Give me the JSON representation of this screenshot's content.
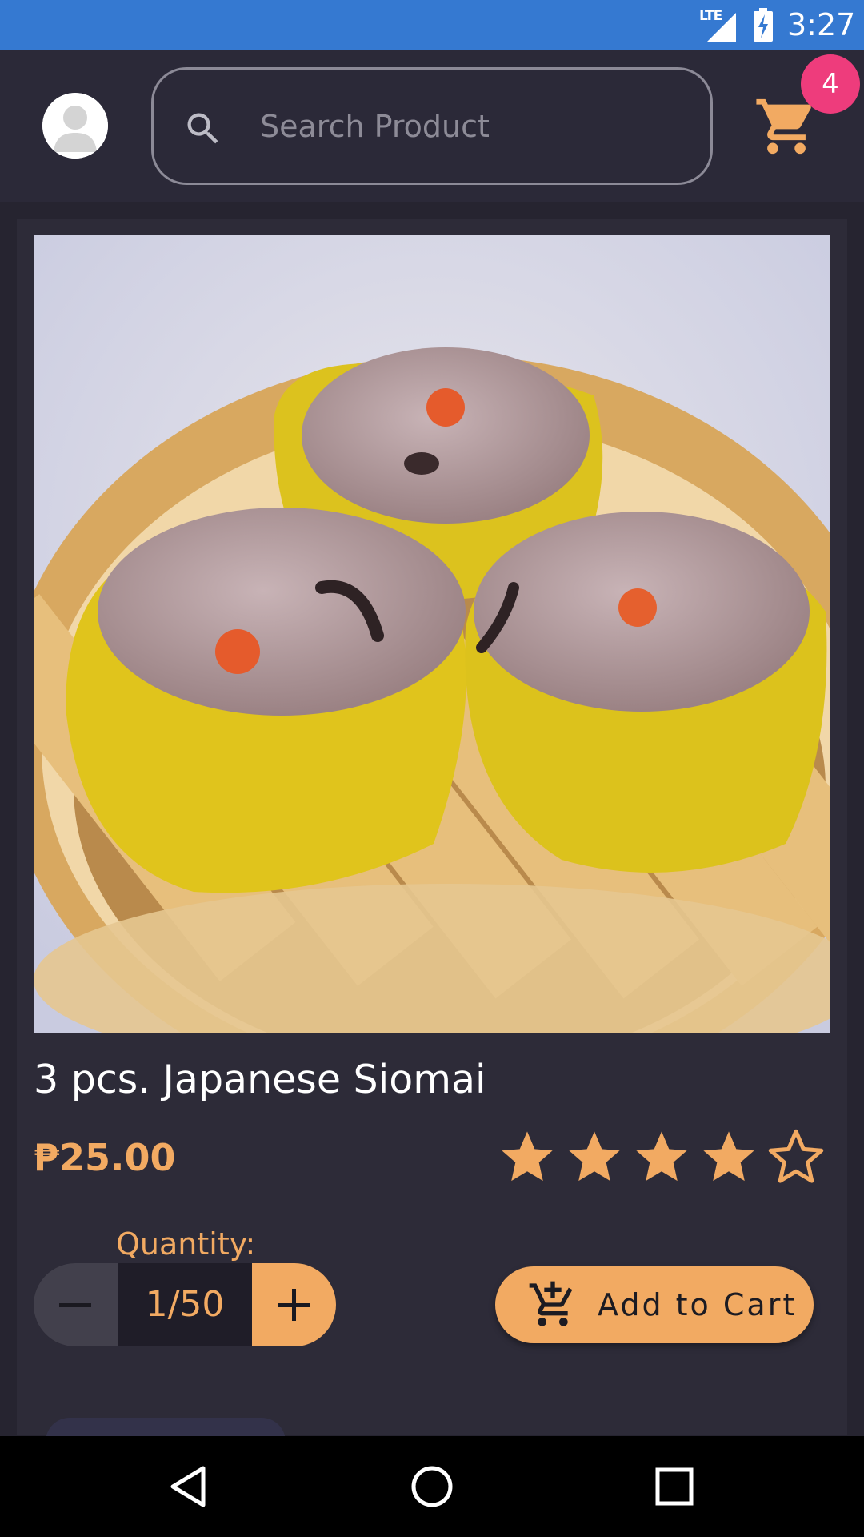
{
  "status_bar": {
    "network": "LTE",
    "time": "3:27"
  },
  "header": {
    "search": {
      "placeholder": "Search Product",
      "value": ""
    },
    "cart_count": "4"
  },
  "product": {
    "title": "3 pcs. Japanese Siomai",
    "price": "₱25.00",
    "rating": 4,
    "rating_max": 5,
    "image_description_icon": "steamed-siomai-image",
    "quantity": {
      "label": "Quantity:",
      "value": "1/50"
    },
    "add_to_cart_label": "Add to Cart"
  },
  "colors": {
    "accent": "#f2aa62",
    "status_bar": "#3579d1",
    "badge": "#ee3c7c",
    "background": "#262430",
    "card": "#2d2b38"
  },
  "icons": {
    "avatar": "user-avatar-icon",
    "search": "search-icon",
    "cart": "cart-icon",
    "minus": "minus-icon",
    "plus": "plus-icon",
    "add_cart": "add-shopping-cart-icon",
    "nav_back": "back-triangle-icon",
    "nav_home": "home-circle-icon",
    "nav_recents": "recents-square-icon"
  }
}
